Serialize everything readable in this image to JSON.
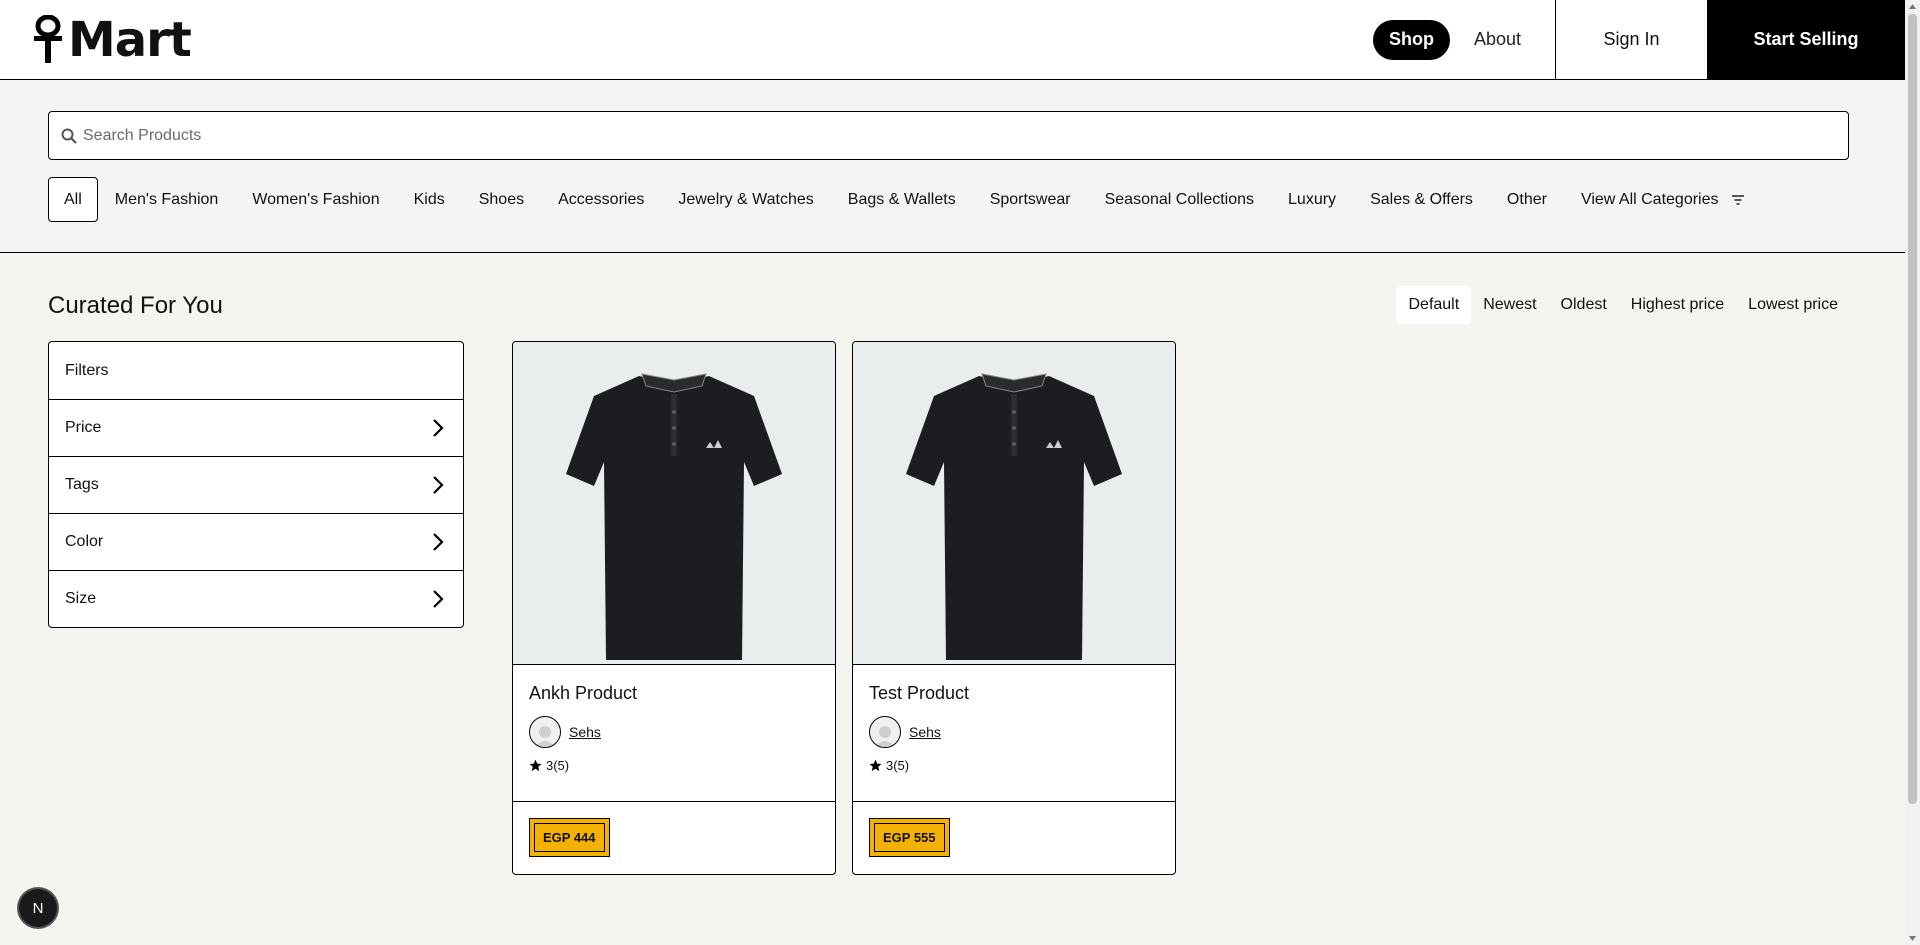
{
  "brand": {
    "name": "Mart"
  },
  "nav": {
    "shop": "Shop",
    "about": "About",
    "sign_in": "Sign In",
    "start_selling": "Start Selling"
  },
  "search": {
    "placeholder": "Search Products"
  },
  "categories": [
    "All",
    "Men's Fashion",
    "Women's Fashion",
    "Kids",
    "Shoes",
    "Accessories",
    "Jewelry & Watches",
    "Bags & Wallets",
    "Sportswear",
    "Seasonal Collections",
    "Luxury",
    "Sales & Offers",
    "Other",
    "View All Categories"
  ],
  "main": {
    "title": "Curated For You"
  },
  "sort": {
    "options": [
      "Default",
      "Newest",
      "Oldest",
      "Highest price",
      "Lowest price"
    ],
    "selected": "Default"
  },
  "filters": {
    "header": "Filters",
    "items": [
      "Price",
      "Tags",
      "Color",
      "Size"
    ]
  },
  "products": [
    {
      "name": "Ankh Product",
      "seller": "Sehs",
      "rating": "3(5)",
      "price": "EGP 444"
    },
    {
      "name": "Test Product",
      "seller": "Sehs",
      "rating": "3(5)",
      "price": "EGP 555"
    }
  ],
  "dev_badge": "N",
  "colors": {
    "accent": "#f5b100",
    "text": "#111111",
    "bg": "#f4f4f0"
  },
  "icons": [
    "ankh-icon",
    "search-icon",
    "filter-icon",
    "chevron-right-icon",
    "star-icon",
    "avatar-icon"
  ]
}
